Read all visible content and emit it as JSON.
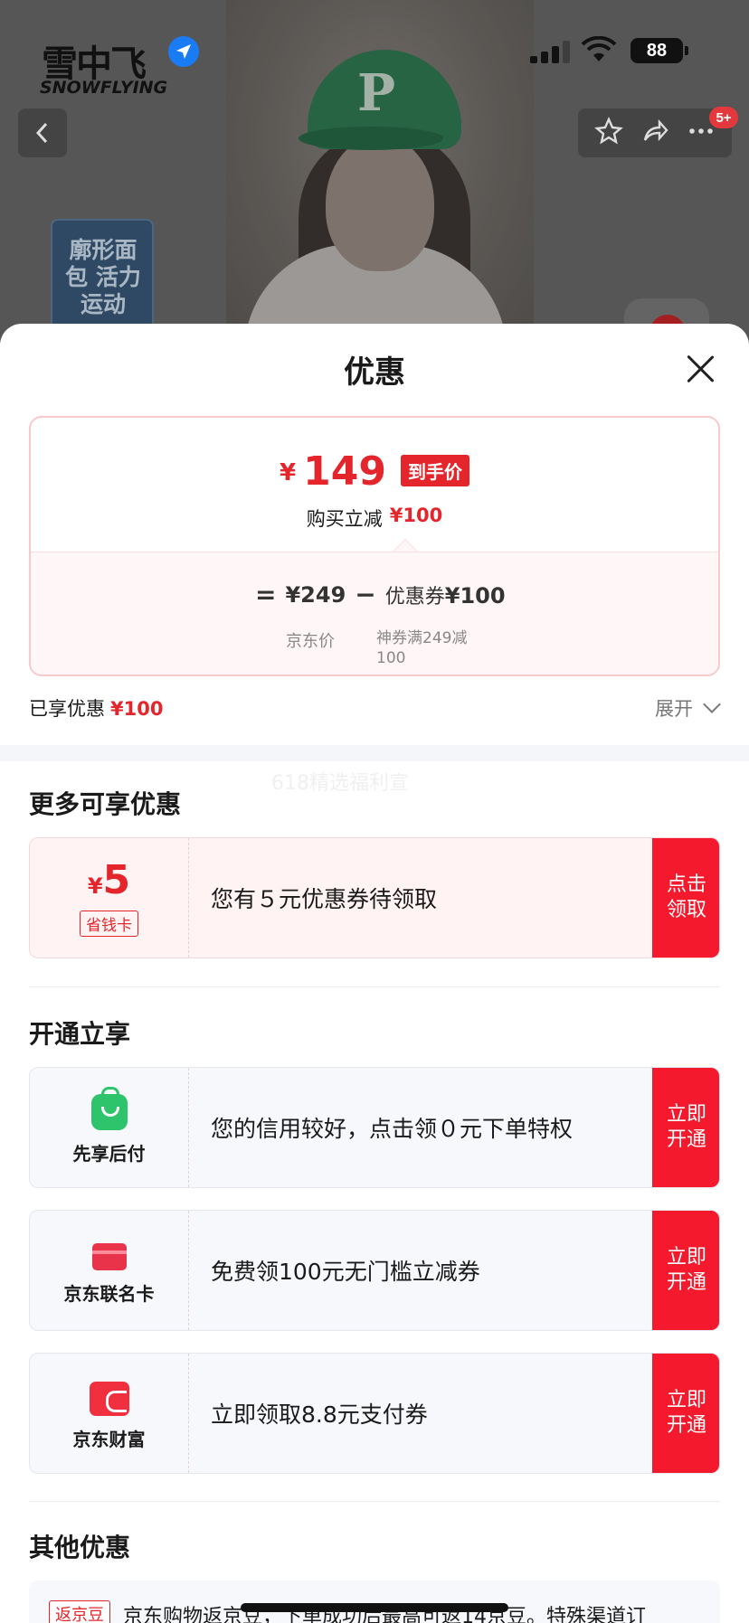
{
  "status_bar": {
    "logo_cn": "雪中飞",
    "logo_en": "SNOWFLYING",
    "battery": "88",
    "location_icon": "location-arrow-icon"
  },
  "nav": {
    "back_icon": "chevron-left-icon",
    "favorite_icon": "star-icon",
    "share_icon": "share-icon",
    "more_icon": "more-dots-icon",
    "message_badge": "5+"
  },
  "background": {
    "promo_tag": "廓形面包 活力运动",
    "hat_letter": "P"
  },
  "sheet": {
    "title": "优惠",
    "close_icon": "close-icon"
  },
  "price_summary": {
    "final_currency": "¥",
    "final_price": "149",
    "final_tag": "到手价",
    "reduce_label": "购买立减",
    "reduce_amount": "¥100",
    "equals": "=",
    "minus": "−",
    "jd_price": "¥249",
    "jd_price_label": "京东价",
    "coupon_label": "优惠券",
    "coupon_amount": "¥100",
    "coupon_desc": "神券满249减100"
  },
  "enjoyed": {
    "label": "已享优惠",
    "amount": "¥100",
    "expand": "展开"
  },
  "ghost_banner": "618精选福利宣",
  "more_offers": {
    "title": "更多可享优惠",
    "coupon": {
      "currency": "¥",
      "value": "5",
      "tag": "省钱卡",
      "text": "您有５元优惠券待领取",
      "button": "点击领取"
    }
  },
  "open_enjoy": {
    "title": "开通立享",
    "items": [
      {
        "icon": "shopping-bag-icon",
        "label": "先享后付",
        "text": "您的信用较好，点击领０元下单特权",
        "button": "立即开通"
      },
      {
        "icon": "bank-card-icon",
        "label": "京东联名卡",
        "text": "免费领100元无门槛立减券",
        "button": "立即开通"
      },
      {
        "icon": "jd-wealth-icon",
        "label": "京东财富",
        "text": "立即领取8.8元支付券",
        "button": "立即开通"
      }
    ]
  },
  "other_offers": {
    "title": "其他优惠",
    "bean_tag": "返京豆",
    "bean_text": "京东购物返京豆，下单成功后最高可返14京豆。特殊渠道订"
  }
}
